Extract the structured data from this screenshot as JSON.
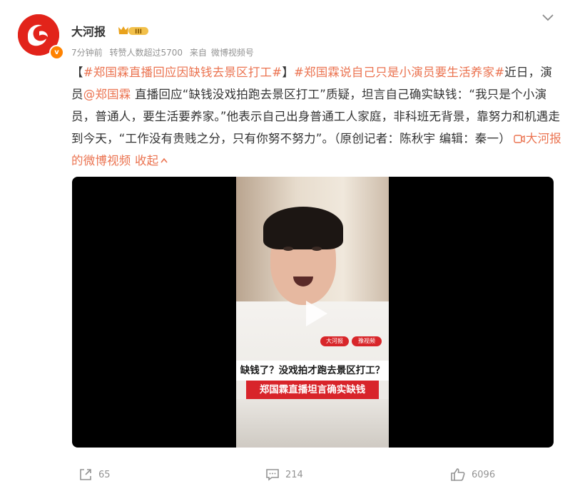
{
  "account": {
    "name": "大河报",
    "level": "III",
    "verified_mark": "v"
  },
  "meta": {
    "time": "7分钟前",
    "reposts_info": "转赞人数超过5700",
    "source_prefix": "来自",
    "source": "微博视频号"
  },
  "post": {
    "bracket_open": "【",
    "topic1": "#郑国霖直播回应因缺钱去景区打工#",
    "bracket_close": "】",
    "topic2": "#郑国霖说自己只是小演员要生活养家#",
    "text1": "近日，演员",
    "mention": "@郑国霖",
    "text2": " 直播回应“缺钱没戏拍跑去景区打工”质疑，坦言自己确实缺钱：“我只是个小演员，普通人，要生活要养家。”他表示自己出身普通工人家庭，非科班无背景，靠努力和机遇走到今天，“工作没有贵贱之分，只有你努不努力”。（原创记者：陈秋宇 编辑：秦一）",
    "video_link": "大河报的微博视频",
    "collapse": "收起"
  },
  "video": {
    "caption_line1": "缺钱了？没戏拍才跑去景区打工？",
    "caption_line2": "郑国霖直播坦言确实缺钱",
    "logo_left": "大河报",
    "logo_right": "豫视频"
  },
  "actions": {
    "share_count": "65",
    "comment_count": "214",
    "like_count": "6096"
  },
  "colors": {
    "link": "#eb7350",
    "muted": "#939393",
    "brand_red": "#e2231a"
  }
}
